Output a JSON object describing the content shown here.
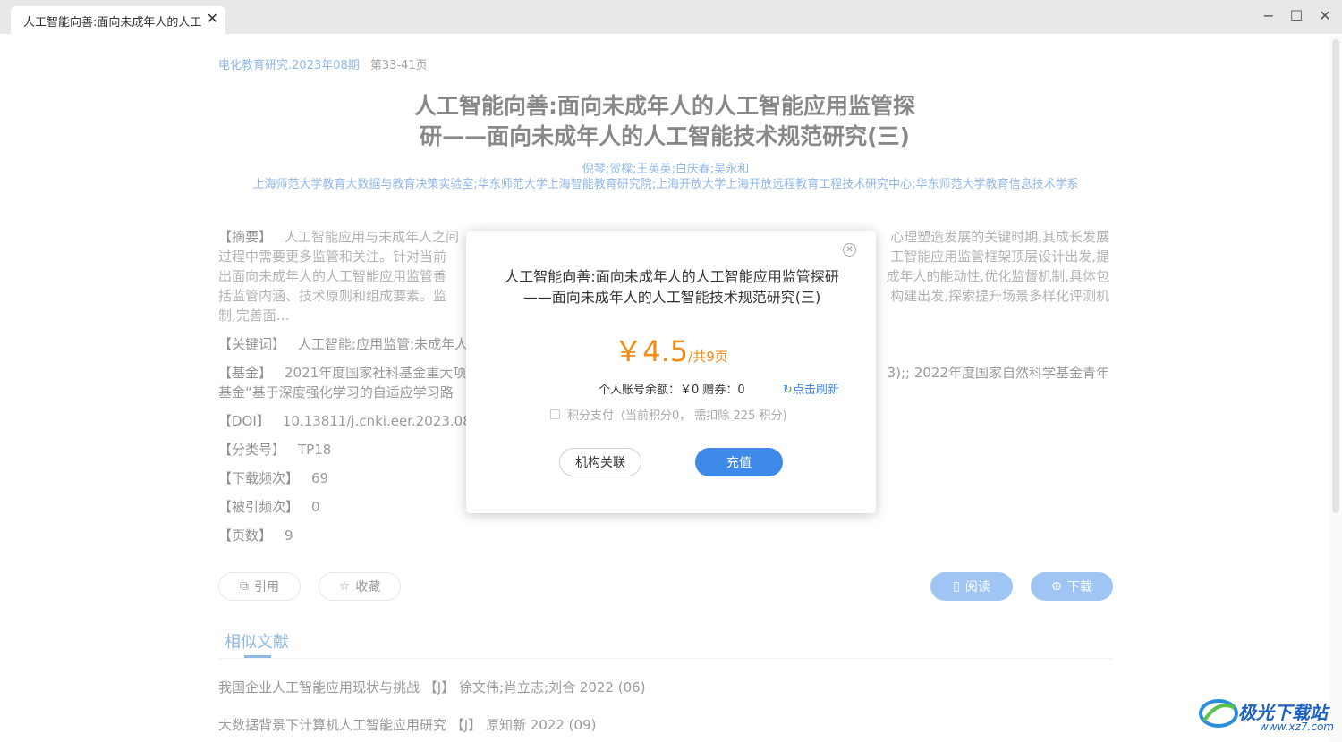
{
  "window": {
    "tab_title": "人工智能向善:面向未成年人的人工智能",
    "minimize": "−",
    "maximize": "☐",
    "close": "✕"
  },
  "article": {
    "journal": "电化教育研究.2023年08期",
    "pages": "第33-41页",
    "title_line1": "人工智能向善:面向未成年人的人工智能应用监管探",
    "title_line2": "研——面向未成年人的人工智能技术规范研究(三)",
    "authors": "倪琴;贺樑;王英英;白庆春;吴永和",
    "orgs": "上海师范大学教育大数据与教育决策实验室;华东师范大学上海智能教育研究院;上海开放大学上海开放远程教育工程技术研究中心;华东师范大学教育信息技术学系"
  },
  "meta": {
    "abstract_label": "【摘要】",
    "abstract_l1": "人工智能应用与未成年人之间",
    "abstract_l1b": "心理塑造发展的关键时期,其成长发展",
    "abstract_l2": "过程中需要更多监管和关注。针对当前",
    "abstract_l2b": "工智能应用监管框架顶层设计出发,提",
    "abstract_l3": "出面向未成年人的人工智能应用监管善",
    "abstract_l3b": "成年人的能动性,优化监督机制,具体包",
    "abstract_l4": "括监管内涵、技术原则和组成要素。监",
    "abstract_l4b": "构建出发,探索提升场景多样化评测机",
    "abstract_l5": "制,完善面…",
    "keywords_label": "【关键词】",
    "keywords": "人工智能;应用监管;未成年人",
    "fund_label": "【基金】",
    "fund_l1": "2021年度国家社科基金重大项",
    "fund_l1b": "3);; 2022年度国家自然科学基金青年",
    "fund_l2": "基金“基于深度强化学习的自适应学习路",
    "doi_label": "【DOI】",
    "doi": "10.13811/j.cnki.eer.2023.08",
    "class_label": "【分类号】",
    "class": "TP18",
    "downloads_label": "【下载频次】",
    "downloads": "69",
    "cited_label": "【被引频次】",
    "cited": "0",
    "pagecount_label": "【页数】",
    "pagecount": "9"
  },
  "actions": {
    "cite": "引用",
    "favorite": "收藏",
    "read": "阅读",
    "download": "下载"
  },
  "similar": {
    "title": "相似文献",
    "items": [
      "我国企业人工智能应用现状与挑战 【J】 徐文伟;肖立志;刘合 2022 (06)",
      "大数据背景下计算机人工智能应用研究 【J】 原知新 2022 (09)"
    ]
  },
  "modal": {
    "title_line1": "人工智能向善:面向未成年人的人工智能应用监管探研",
    "title_line2": "——面向未成年人的人工智能技术规范研究(三)",
    "price": "￥4.5",
    "price_suffix": "/共9页",
    "balance": "个人账号余额：￥0 赠券：0",
    "refresh": "点击刷新",
    "points": "积分支付（当前积分0， 需扣除 225 积分)",
    "org_button": "机构关联",
    "recharge_button": "充值"
  },
  "watermark": {
    "brand": "极光下载站",
    "url": "www.xz7.com"
  },
  "colors": {
    "accent": "#3f8ae8",
    "link": "#1e6fd1",
    "price": "#f08c1a"
  }
}
